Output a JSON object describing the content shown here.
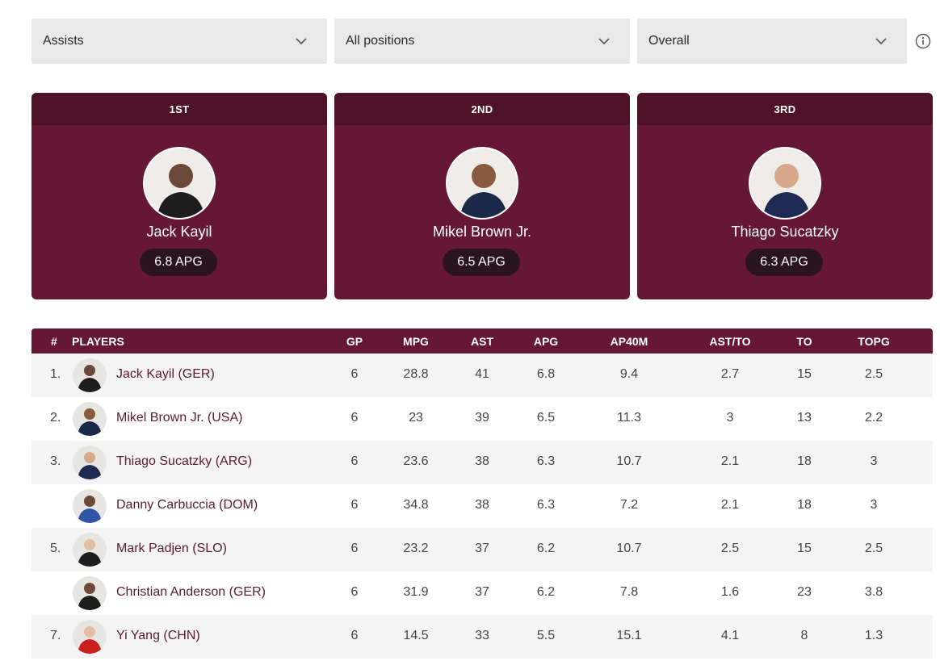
{
  "filters": {
    "stat": "Assists",
    "position": "All positions",
    "scope": "Overall"
  },
  "podium": [
    {
      "place": "1ST",
      "name": "Jack Kayil",
      "value": "6.8 APG"
    },
    {
      "place": "2ND",
      "name": "Mikel Brown Jr.",
      "value": "6.5 APG"
    },
    {
      "place": "3RD",
      "name": "Thiago Sucatzky",
      "value": "6.3 APG"
    }
  ],
  "table": {
    "headers": {
      "rank": "#",
      "players": "PLAYERS",
      "gp": "GP",
      "mpg": "MPG",
      "ast": "AST",
      "apg": "APG",
      "ap40m": "AP40M",
      "astto": "AST/TO",
      "to": "TO",
      "topg": "TOPG"
    },
    "rows": [
      {
        "rank": "1.",
        "name": "Jack Kayil (GER)",
        "gp": "6",
        "mpg": "28.8",
        "ast": "41",
        "apg": "6.8",
        "ap40m": "9.4",
        "astto": "2.7",
        "to": "15",
        "topg": "2.5"
      },
      {
        "rank": "2.",
        "name": "Mikel Brown Jr. (USA)",
        "gp": "6",
        "mpg": "23",
        "ast": "39",
        "apg": "6.5",
        "ap40m": "11.3",
        "astto": "3",
        "to": "13",
        "topg": "2.2"
      },
      {
        "rank": "3.",
        "name": "Thiago Sucatzky (ARG)",
        "gp": "6",
        "mpg": "23.6",
        "ast": "38",
        "apg": "6.3",
        "ap40m": "10.7",
        "astto": "2.1",
        "to": "18",
        "topg": "3"
      },
      {
        "rank": "",
        "name": "Danny Carbuccia (DOM)",
        "gp": "6",
        "mpg": "34.8",
        "ast": "38",
        "apg": "6.3",
        "ap40m": "7.2",
        "astto": "2.1",
        "to": "18",
        "topg": "3"
      },
      {
        "rank": "5.",
        "name": "Mark Padjen (SLO)",
        "gp": "6",
        "mpg": "23.2",
        "ast": "37",
        "apg": "6.2",
        "ap40m": "10.7",
        "astto": "2.5",
        "to": "15",
        "topg": "2.5"
      },
      {
        "rank": "",
        "name": "Christian Anderson (GER)",
        "gp": "6",
        "mpg": "31.9",
        "ast": "37",
        "apg": "6.2",
        "ap40m": "7.8",
        "astto": "1.6",
        "to": "23",
        "topg": "3.8"
      },
      {
        "rank": "7.",
        "name": "Yi Yang (CHN)",
        "gp": "6",
        "mpg": "14.5",
        "ast": "33",
        "apg": "5.5",
        "ap40m": "15.1",
        "astto": "4.1",
        "to": "8",
        "topg": "1.3"
      }
    ]
  },
  "colors": {
    "brand": "#661736",
    "brand_dark": "#4e1228",
    "pill": "#2a1420"
  }
}
